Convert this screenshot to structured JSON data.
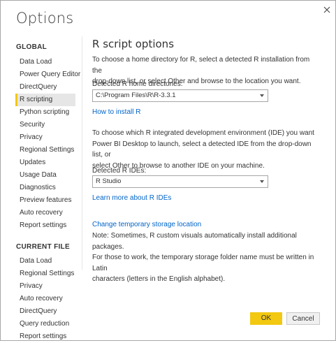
{
  "window": {
    "title": "Options"
  },
  "sidebar": {
    "global_header": "GLOBAL",
    "global_items": [
      {
        "label": "Data Load"
      },
      {
        "label": "Power Query Editor"
      },
      {
        "label": "DirectQuery"
      },
      {
        "label": "R scripting"
      },
      {
        "label": "Python scripting"
      },
      {
        "label": "Security"
      },
      {
        "label": "Privacy"
      },
      {
        "label": "Regional Settings"
      },
      {
        "label": "Updates"
      },
      {
        "label": "Usage Data"
      },
      {
        "label": "Diagnostics"
      },
      {
        "label": "Preview features"
      },
      {
        "label": "Auto recovery"
      },
      {
        "label": "Report settings"
      }
    ],
    "current_header": "CURRENT FILE",
    "current_items": [
      {
        "label": "Data Load"
      },
      {
        "label": "Regional Settings"
      },
      {
        "label": "Privacy"
      },
      {
        "label": "Auto recovery"
      },
      {
        "label": "DirectQuery"
      },
      {
        "label": "Query reduction"
      },
      {
        "label": "Report settings"
      }
    ],
    "selected": "R scripting"
  },
  "main": {
    "heading": "R script options",
    "intro_lines": [
      "To choose a home directory for R, select a detected R installation from the",
      "drop-down list, or select Other and browse to the location you want."
    ],
    "home_label": "Detected R home directories:",
    "home_value": "C:\\Program Files\\R\\R-3.3.1",
    "install_link": "How to install R",
    "ide_lines": [
      "To choose which R integrated development environment (IDE) you want",
      "Power BI Desktop to launch, select a detected IDE from the drop-down list, or",
      "select Other to browse to another IDE on your machine."
    ],
    "ide_label": "Detected R IDEs:",
    "ide_value": "R Studio",
    "ide_link": "Learn more about R IDEs",
    "storage_link": "Change temporary storage location",
    "note_lines": [
      "Note: Sometimes, R custom visuals automatically install additional packages.",
      "For those to work, the temporary storage folder name must be written in Latin",
      "characters (letters in the English alphabet)."
    ]
  },
  "footer": {
    "ok_label": "OK",
    "cancel_label": "Cancel"
  }
}
